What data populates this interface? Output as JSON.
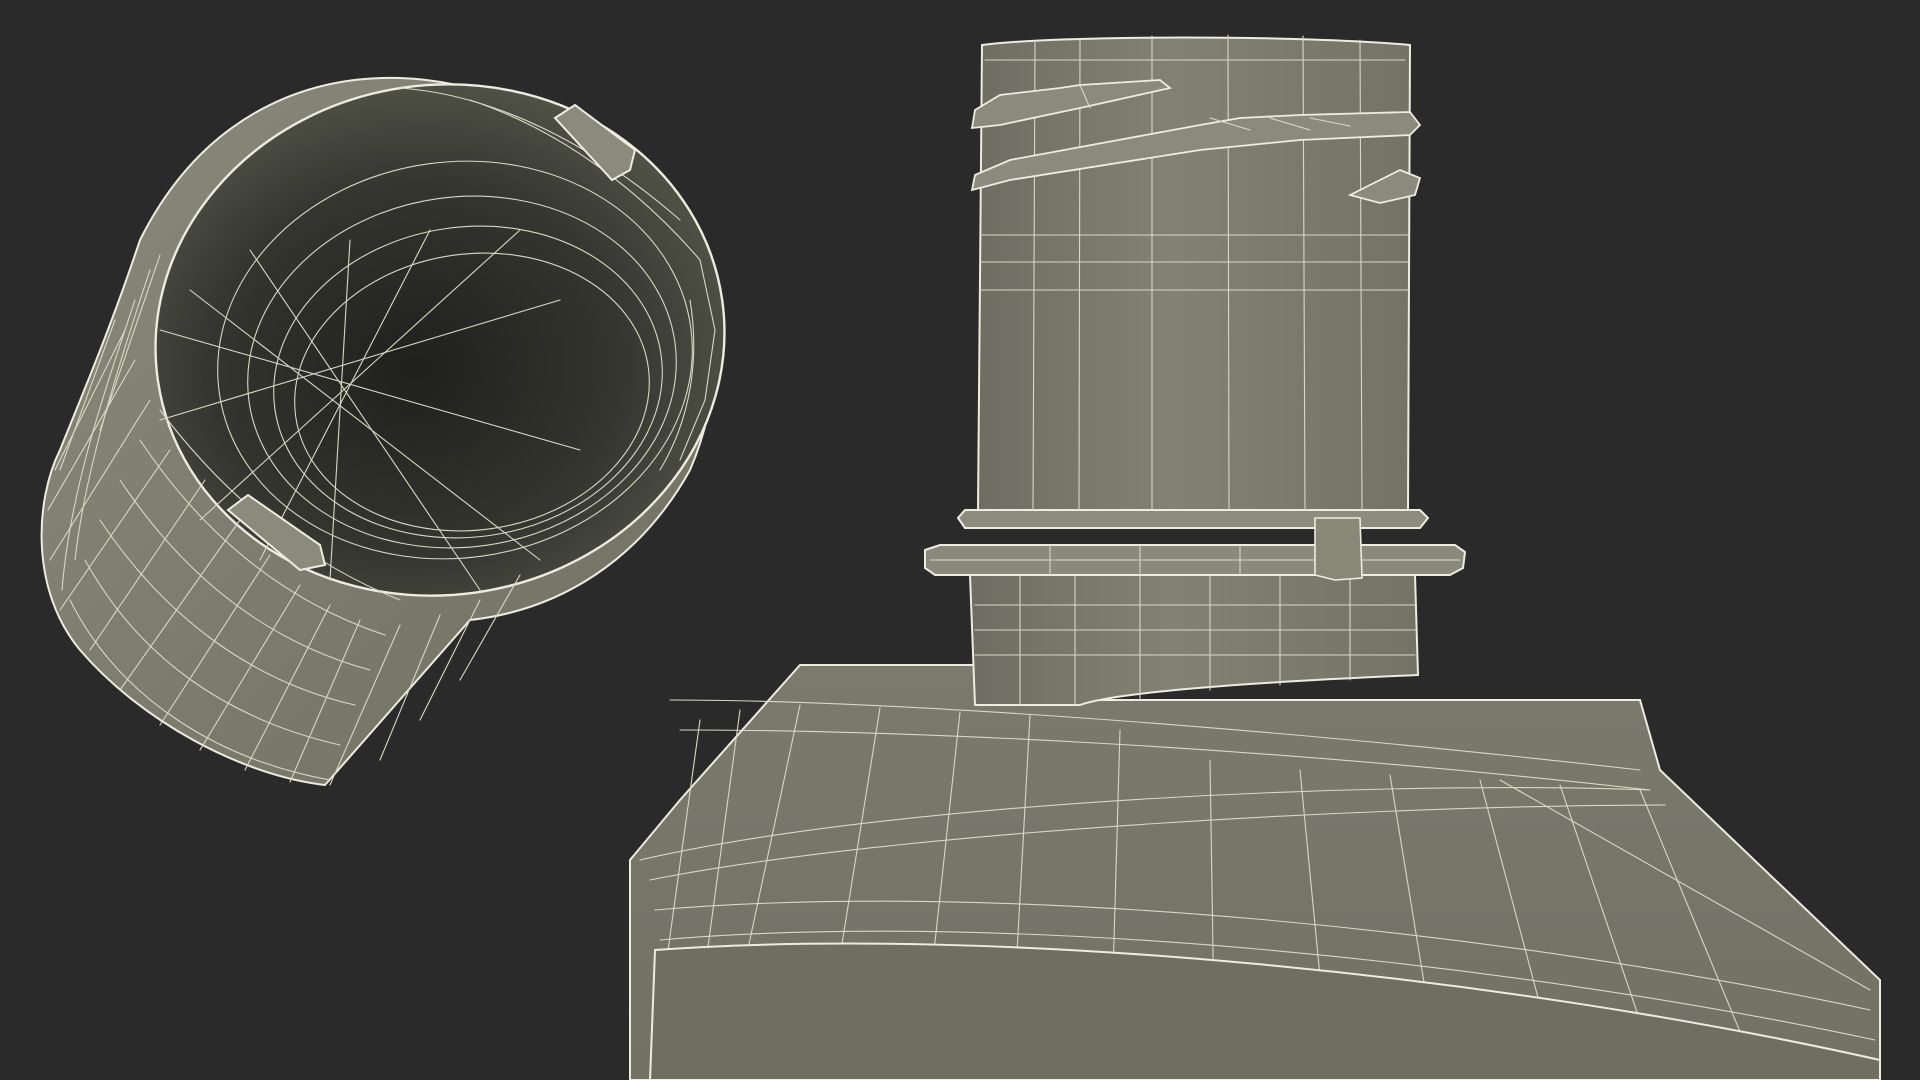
{
  "scene": {
    "background_color": "#2a2a2a",
    "mesh_color": "#7a7a6c",
    "mesh_dark_color": "#45463e",
    "wire_color": "#d8d8c6",
    "objects": [
      "bottle-cap",
      "bottle"
    ]
  }
}
